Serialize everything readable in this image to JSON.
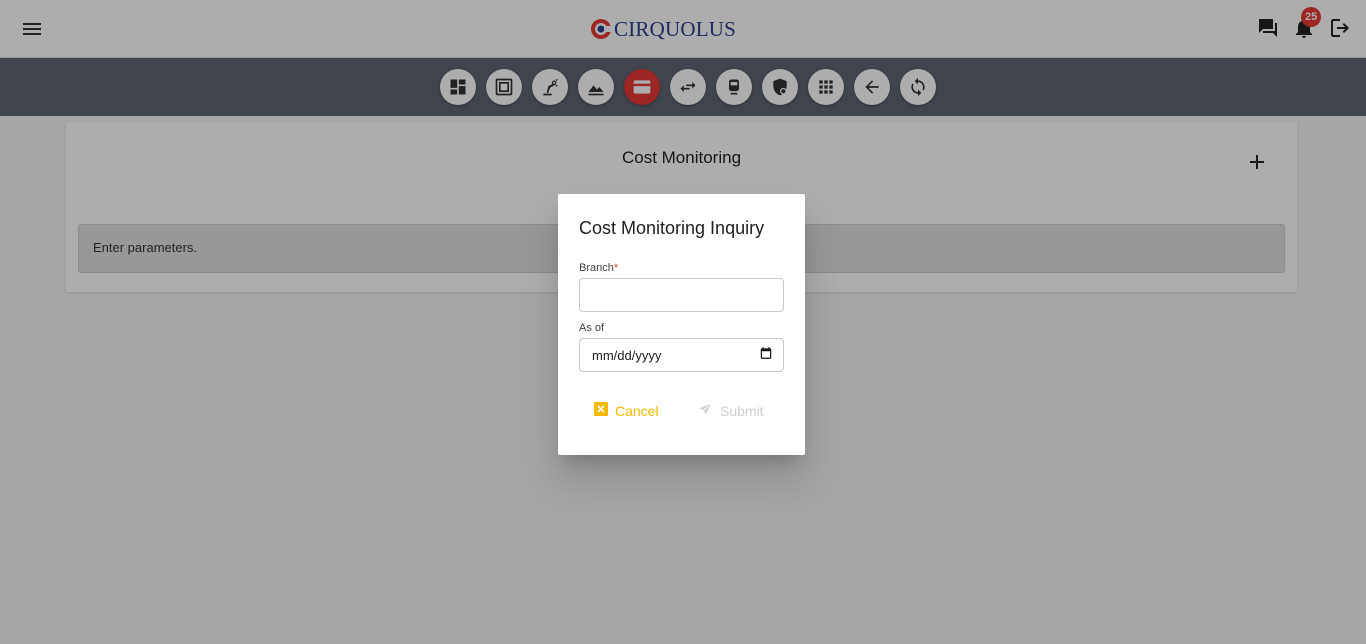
{
  "header": {
    "brand": "CIRQUOLUS",
    "notification_count": "25",
    "icons": [
      "menu-icon",
      "chat-icon",
      "bell-icon",
      "logout-icon"
    ]
  },
  "toolbar": {
    "tools": [
      {
        "name": "dashboard-icon",
        "active": false
      },
      {
        "name": "frame-icon",
        "active": false
      },
      {
        "name": "robot-arm-icon",
        "active": false
      },
      {
        "name": "landscape-icon",
        "active": false
      },
      {
        "name": "credit-card-icon",
        "active": true
      },
      {
        "name": "swap-icon",
        "active": false
      },
      {
        "name": "train-icon",
        "active": false
      },
      {
        "name": "shield-icon",
        "active": false
      },
      {
        "name": "apps-grid-icon",
        "active": false
      },
      {
        "name": "arrow-back-icon",
        "active": false
      },
      {
        "name": "refresh-icon",
        "active": false
      }
    ],
    "active_color": "#e53935"
  },
  "page": {
    "title": "Cost Monitoring",
    "info_message": "Enter parameters."
  },
  "dialog": {
    "title": "Cost Monitoring Inquiry",
    "branch_label": "Branch",
    "branch_required_mark": "*",
    "branch_value": "",
    "as_of_label": "As of",
    "as_of_placeholder": "mm/dd/yyyy",
    "cancel_label": "Cancel",
    "submit_label": "Submit",
    "cancel_color": "#f5b800"
  }
}
